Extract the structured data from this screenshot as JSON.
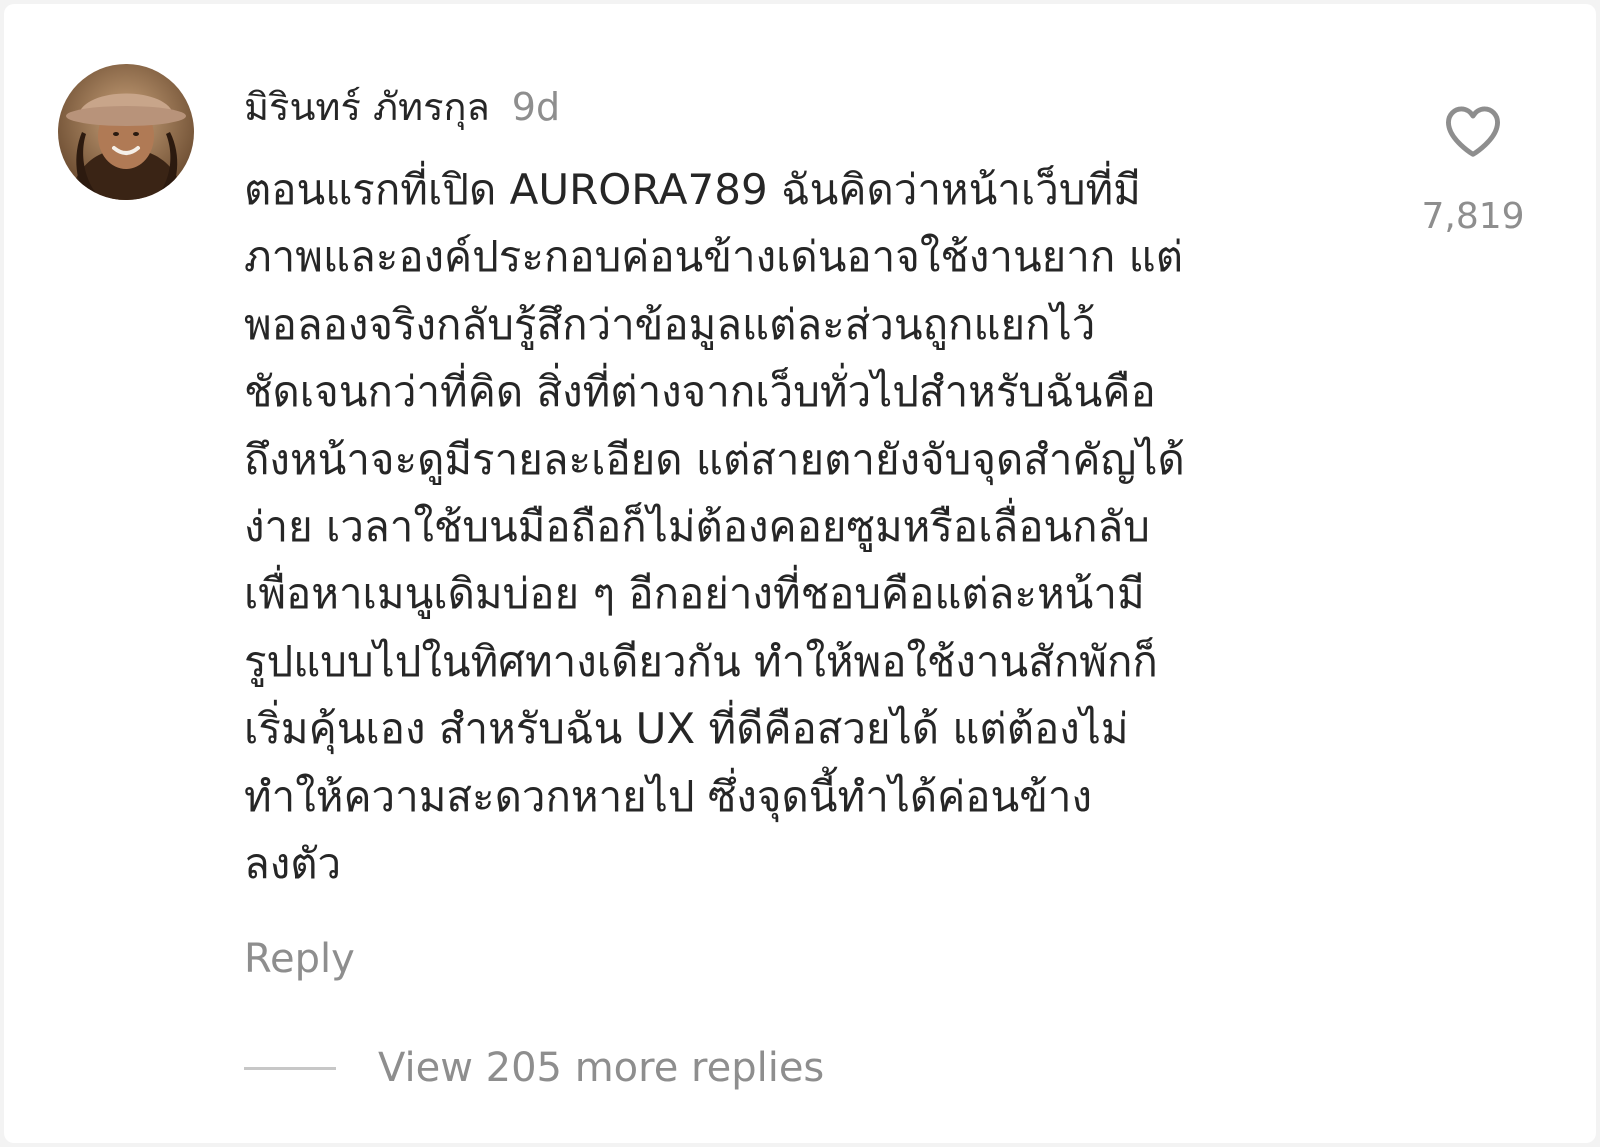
{
  "comment": {
    "username": "มิรินทร์ ภัทรกุล",
    "timestamp": "9d",
    "text_lines": [
      "ตอนแรกที่เปิด AURORA789 ฉันคิดว่าหน้าเว็บที่มี",
      "ภาพและองค์ประกอบค่อนข้างเด่นอาจใช้งานยาก แต่",
      "พอลองจริงกลับรู้สึกว่าข้อมูลแต่ละส่วนถูกแยกไว้",
      "ชัดเจนกว่าที่คิด สิ่งที่ต่างจากเว็บทั่วไปสำหรับฉันคือ",
      "ถึงหน้าจะดูมีรายละเอียด แต่สายตายังจับจุดสำคัญได้",
      "ง่าย เวลาใช้บนมือถือก็ไม่ต้องคอยซูมหรือเลื่อนกลับ",
      "เพื่อหาเมนูเดิมบ่อย ๆ อีกอย่างที่ชอบคือแต่ละหน้ามี",
      "รูปแบบไปในทิศทางเดียวกัน ทำให้พอใช้งานสักพักก็",
      "เริ่มคุ้นเอง สำหรับฉัน UX ที่ดีคือสวยได้ แต่ต้องไม่",
      "ทำให้ความสะดวกหายไป ซึ่งจุดนี้ทำได้ค่อนข้าง",
      "ลงตัว"
    ],
    "like_icon": "heart-outline-icon",
    "like_count": "7,819",
    "reply_label": "Reply",
    "view_replies_label": "View 205 more replies"
  },
  "colors": {
    "text_primary": "#262626",
    "text_secondary": "#8e8e8e",
    "background": "#ffffff"
  }
}
